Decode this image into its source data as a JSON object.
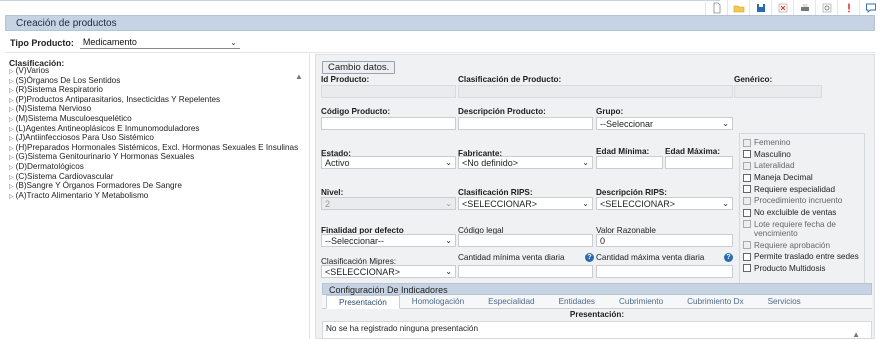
{
  "title": "Creación de productos",
  "tipo_producto": {
    "label": "Tipo Producto:",
    "value": "Medicamento"
  },
  "clasificacion": {
    "heading": "Clasificación:",
    "items": [
      "(V)Varios",
      "(S)Órganos De Los Sentidos",
      "(R)Sistema Respiratorio",
      "(P)Productos Antiparasitarios, Insecticidas Y Repelentes",
      "(N)Sistema Nervioso",
      "(M)Sistema Musculoesquelético",
      "(L)Agentes Antineoplásicos E Inmunomoduladores",
      "(J)Antiinfecciosos Para Uso Sistémico",
      "(H)Preparados Hormonales Sistémicos, Excl. Hormonas Sexuales E Insulinas",
      "(G)Sistema Genitourinario Y Hormonas Sexuales",
      "(D)Dermatológicos",
      "(C)Sistema Cardiovascular",
      "(B)Sangre Y Órganos Formadores De Sangre",
      "(A)Tracto Alimentario Y Metabolismo"
    ]
  },
  "form": {
    "cambio_datos": "Cambio datos.",
    "id_producto": {
      "label": "Id Producto:",
      "value": ""
    },
    "clasificacion_producto": {
      "label": "Clasificación de Producto:",
      "value": ""
    },
    "generico": {
      "label": "Genérico:",
      "value": ""
    },
    "codigo_producto": {
      "label": "Código Producto:",
      "value": ""
    },
    "descripcion_producto": {
      "label": "Descripción Producto:",
      "value": ""
    },
    "grupo": {
      "label": "Grupo:",
      "value": "--Seleccionar"
    },
    "estado": {
      "label": "Estado:",
      "value": "Activo"
    },
    "fabricante": {
      "label": "Fabricante:",
      "value": "<No definido>"
    },
    "edad_minima": {
      "label": "Edad Mínima:",
      "value": ""
    },
    "edad_maxima": {
      "label": "Edad Máxima:",
      "value": ""
    },
    "nivel": {
      "label": "Nivel:",
      "value": "2"
    },
    "clasificacion_rips": {
      "label": "Clasificación RIPS:",
      "value": "<SELECCIONAR>"
    },
    "descripcion_rips": {
      "label": "Descripción RIPS:",
      "value": "<SELECCIONAR>"
    },
    "finalidad": {
      "label": "Finalidad por defecto",
      "value": "--Seleccionar--"
    },
    "codigo_legal": {
      "label": "Código legal",
      "value": ""
    },
    "valor_razonable": {
      "label": "Valor Razonable",
      "value": "0"
    },
    "clasificacion_mipres": {
      "label": "Clasificación Mipres:",
      "value": "<SELECCIONAR>"
    },
    "cantidad_minima": {
      "label": "Cantidad mínima venta diaria",
      "value": ""
    },
    "cantidad_maxima": {
      "label": "Cantidad máxima venta diaria",
      "value": ""
    }
  },
  "checkboxes": [
    {
      "label": "Femenino",
      "disabled": true
    },
    {
      "label": "Masculino",
      "disabled": false
    },
    {
      "label": "Lateralidad",
      "disabled": true
    },
    {
      "label": "Maneja Decimal",
      "disabled": false
    },
    {
      "label": "Requiere especialidad",
      "disabled": false
    },
    {
      "label": "Procedimiento incruento",
      "disabled": true
    },
    {
      "label": "No excluible de ventas",
      "disabled": false
    },
    {
      "label": "Lote requiere fecha de vencimiento",
      "disabled": true
    },
    {
      "label": "Requiere aprobación",
      "disabled": true
    },
    {
      "label": "Permite traslado entre sedes",
      "disabled": false
    },
    {
      "label": "Producto Multidosis",
      "disabled": false
    }
  ],
  "indicadores": {
    "header": "Configuración De Indicadores",
    "tabs": [
      "Presentación",
      "Homologación",
      "Especialidad",
      "Entidades",
      "Cubrimiento",
      "Cubrimiento Dx",
      "Servicios"
    ],
    "active_tab": "Presentación",
    "section_label": "Presentación:",
    "empty_message": "No se ha registrado ninguna presentación"
  },
  "toolbar_icons": [
    "new-document-icon",
    "open-folder-icon",
    "save-icon",
    "excel-icon",
    "print-icon",
    "preview-icon",
    "alert-icon",
    "chat-icon"
  ]
}
